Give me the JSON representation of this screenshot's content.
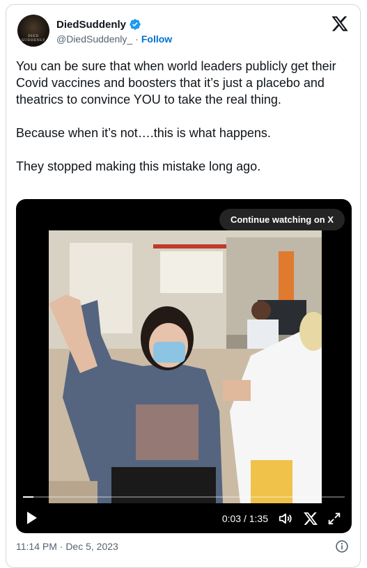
{
  "author": {
    "display_name": "DiedSuddenly",
    "handle": "@DiedSuddenly_",
    "separator": "·",
    "follow_label": "Follow",
    "avatar_text": "DIED SUDDENLY",
    "verified_color": "#1d9bf0"
  },
  "tweet": {
    "paragraphs": [
      "You can be sure that when world leaders publicly get their Covid vaccines and boosters that it’s just a placebo and theatrics to convince YOU to take the real thing.",
      "Because when it’s not….this is what happens.",
      "They stopped making this mistake long ago."
    ]
  },
  "video": {
    "continue_label": "Continue watching on X",
    "current_time": "0:03",
    "duration": "1:35",
    "time_display": "0:03 / 1:35",
    "progress_fraction": 0.032
  },
  "footer": {
    "timestamp": "11:14 PM · Dec 5, 2023"
  },
  "icons": {
    "x_logo": "x-logo-icon",
    "verified": "verified-badge-icon",
    "play": "play-icon",
    "volume": "volume-icon",
    "expand": "expand-icon",
    "info": "info-icon"
  }
}
